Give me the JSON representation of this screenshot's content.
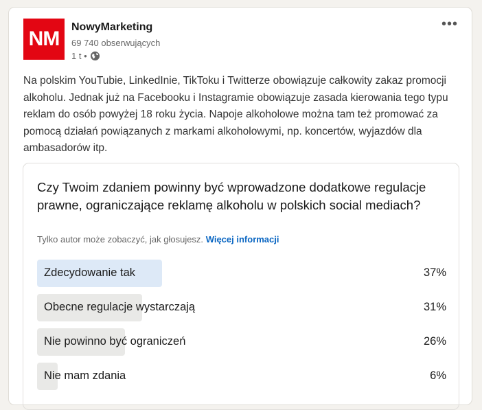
{
  "post": {
    "author": {
      "logo_text": "NM",
      "name": "NowyMarketing",
      "followers": "69 740 obserwujących",
      "time": "1 t •",
      "visibility_icon": "globe-icon"
    },
    "more_icon": "•••",
    "text": "Na polskim YouTubie, LinkedInie, TikToku i Twitterze obowiązuje całkowity zakaz promocji alkoholu. Jednak już na Facebooku i Instagramie obowiązuje zasada kierowania tego typu reklam do osób powyżej 18 roku życia. Napoje alkoholowe można tam też promować za pomocą działań powiązanych z markami alkoholowymi, np. koncertów, wyjazdów dla ambasadorów itp."
  },
  "poll": {
    "question": "Czy Twoim zdaniem powinny być wprowadzone dodatkowe regulacje prawne, ograniczające reklamę alkoholu w polskich social mediach?",
    "note": "Tylko autor może zobaczyć, jak głosujesz.",
    "more_info_link": "Więcej informacji",
    "options": [
      {
        "label": "Zdecydowanie tak",
        "percent_label": "37%",
        "percent": 37,
        "leading": true
      },
      {
        "label": "Obecne regulacje wystarczają",
        "percent_label": "31%",
        "percent": 31,
        "leading": false
      },
      {
        "label": "Nie powinno być ograniczeń",
        "percent_label": "26%",
        "percent": 26,
        "leading": false
      },
      {
        "label": "Nie mam zdania",
        "percent_label": "6%",
        "percent": 6,
        "leading": false
      }
    ]
  },
  "colors": {
    "brand": "#e30613",
    "link": "#0a66c2",
    "leading_bar": "#dde9f7",
    "bar": "#e9e9e7"
  }
}
